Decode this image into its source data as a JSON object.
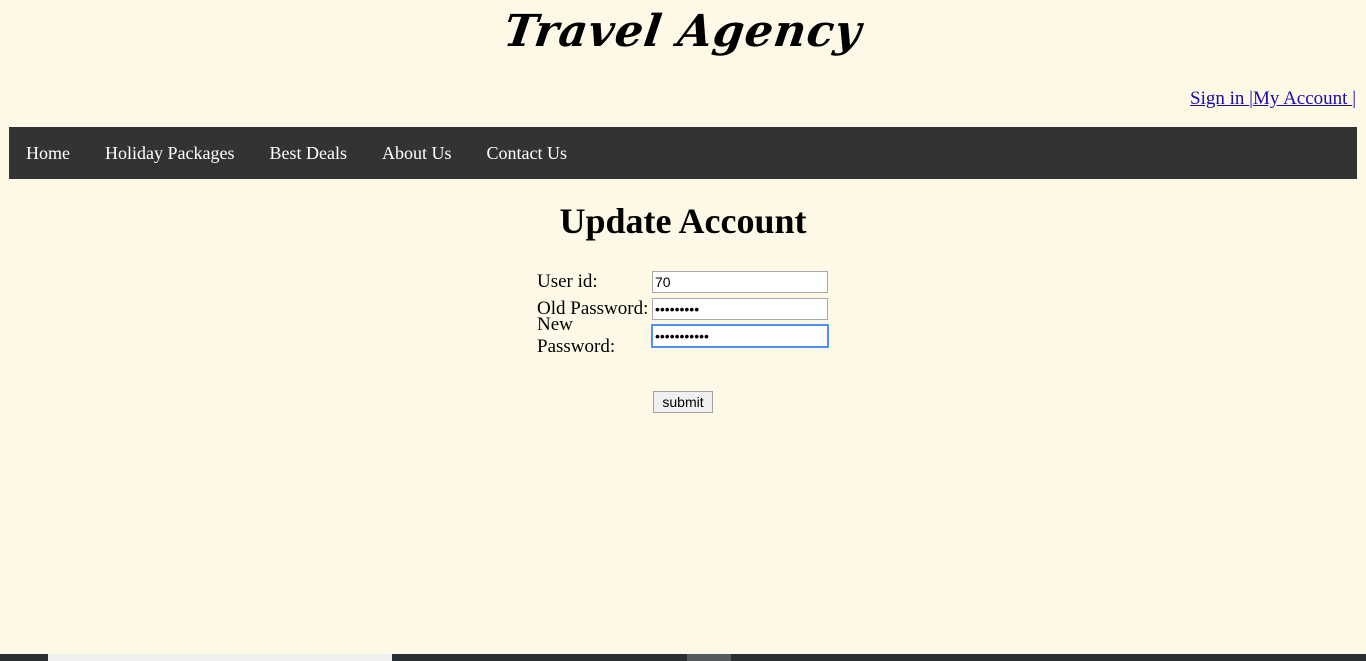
{
  "header": {
    "site_title": "Travel Agency",
    "account_links": {
      "sign_in": "Sign in ",
      "separator1": "|",
      "my_account": "My Account ",
      "separator2": "|"
    }
  },
  "nav": {
    "items": [
      {
        "label": "Home"
      },
      {
        "label": "Holiday Packages"
      },
      {
        "label": "Best Deals"
      },
      {
        "label": "About Us"
      },
      {
        "label": "Contact Us"
      }
    ]
  },
  "form": {
    "title": "Update Account",
    "user_id": {
      "label": "User id:",
      "value": "70"
    },
    "old_password": {
      "label": "Old Password:",
      "value": "•••••••••"
    },
    "new_password": {
      "label": "New Password:",
      "value": "•••••••••••"
    },
    "submit_label": "submit"
  },
  "colors": {
    "background": "#fef8e6",
    "navbar": "#333333",
    "link": "#1a0dab"
  }
}
